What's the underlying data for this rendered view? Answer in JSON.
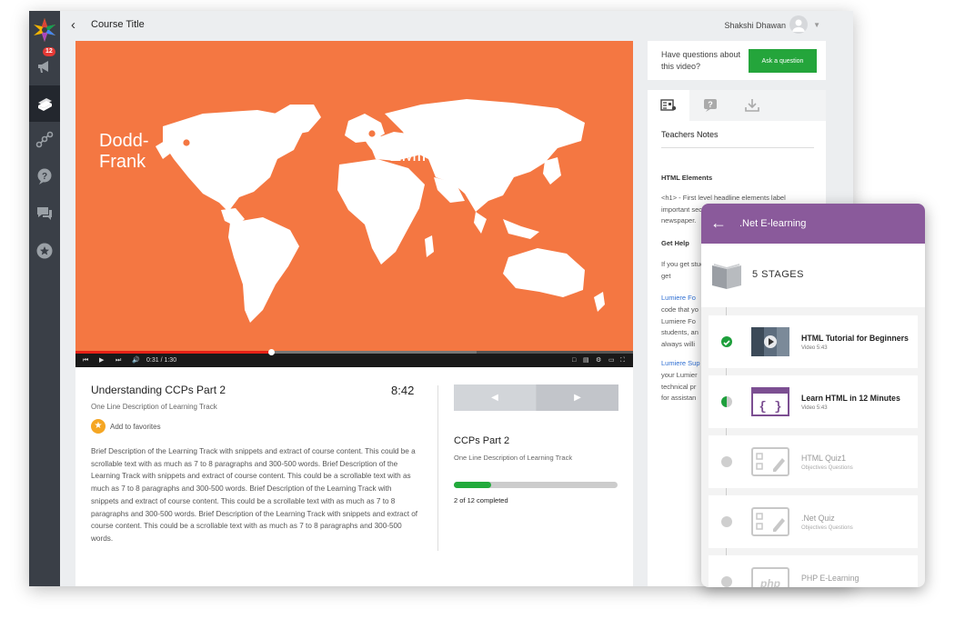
{
  "topbar": {
    "course_title": "Course Title",
    "user_name": "Shakshi Dhawan"
  },
  "rail": {
    "notification_count": "12"
  },
  "video": {
    "label_left_line1": "Dodd-",
    "label_left_line2": "Frank",
    "label_right": "EMIR",
    "time": "0:31 / 1:30",
    "played_fraction": 0.35,
    "buffered_fraction": 0.72
  },
  "info": {
    "title": "Understanding CCPs Part 2",
    "duration": "8:42",
    "subtitle": "One Line Description of Learning Track",
    "favorite_label": "Add to favorites",
    "description": "Brief Description of the Learning Track with snippets and extract of course content. This could be a scrollable text with as much as 7 to 8 paragraphs and 300-500 words. Brief Description of the Learning Track with snippets and extract of course content. This could be a scrollable text with as much as 7 to 8 paragraphs and 300-500 words. Brief Description of the Learning Track with snippets and extract of course content. This could be a scrollable text with as much as 7 to 8 paragraphs and 300-500 words. Brief Description of the Learning Track with snippets and extract of course content. This could be a scrollable text with as much as 7 to 8 paragraphs and 300-500 words."
  },
  "next": {
    "title": "CCPs Part 2",
    "subtitle": "One Line Description of Learning Track",
    "progress": 0.23,
    "completed_text": "2 of 12 completed"
  },
  "question": {
    "text": "Have questions about this video?",
    "button": "Ask a question"
  },
  "notes": {
    "tab_title": "Teachers Notes",
    "h1": "HTML Elements",
    "p1": "<h1> - First level headline elements label important sections of a page, just like in a newspaper.",
    "h2": "Get Help",
    "p2": "If you get stuck, here are a few more ways to get",
    "link1": "Lumiere Fo",
    "p3": "code that yo Lumiere Fo students, an always willi",
    "link2": "Lumiere Sup",
    "p4": "your Lumier technical pr for assistan"
  },
  "mobile": {
    "title": ".Net E-learning",
    "stages": "5 STAGES",
    "items": [
      {
        "title": "HTML Tutorial for Beginners",
        "sub": "Video  5:43",
        "status": "done"
      },
      {
        "title": "Learn HTML in 12 Minutes",
        "sub": "Video  5:43",
        "status": "progress"
      },
      {
        "title": "HTML Quiz1",
        "sub": "Objectives Questions",
        "status": "locked"
      },
      {
        "title": ".Net Quiz",
        "sub": "Objectives Questions",
        "status": "locked"
      },
      {
        "title": "PHP E-Learning",
        "sub": "",
        "status": "locked"
      }
    ]
  },
  "colors": {
    "video_bg": "#f47742",
    "accent_green": "#24a53b",
    "mobile_header": "#8a5a9b",
    "rail": "#3a3f47"
  }
}
